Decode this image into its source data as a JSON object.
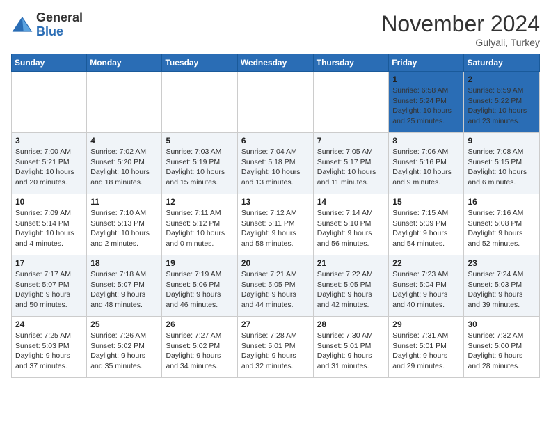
{
  "header": {
    "logo_general": "General",
    "logo_blue": "Blue",
    "month_title": "November 2024",
    "subtitle": "Gulyali, Turkey"
  },
  "weekdays": [
    "Sunday",
    "Monday",
    "Tuesday",
    "Wednesday",
    "Thursday",
    "Friday",
    "Saturday"
  ],
  "weeks": [
    [
      {
        "day": "",
        "info": ""
      },
      {
        "day": "",
        "info": ""
      },
      {
        "day": "",
        "info": ""
      },
      {
        "day": "",
        "info": ""
      },
      {
        "day": "",
        "info": ""
      },
      {
        "day": "1",
        "info": "Sunrise: 6:58 AM\nSunset: 5:24 PM\nDaylight: 10 hours\nand 25 minutes."
      },
      {
        "day": "2",
        "info": "Sunrise: 6:59 AM\nSunset: 5:22 PM\nDaylight: 10 hours\nand 23 minutes."
      }
    ],
    [
      {
        "day": "3",
        "info": "Sunrise: 7:00 AM\nSunset: 5:21 PM\nDaylight: 10 hours\nand 20 minutes."
      },
      {
        "day": "4",
        "info": "Sunrise: 7:02 AM\nSunset: 5:20 PM\nDaylight: 10 hours\nand 18 minutes."
      },
      {
        "day": "5",
        "info": "Sunrise: 7:03 AM\nSunset: 5:19 PM\nDaylight: 10 hours\nand 15 minutes."
      },
      {
        "day": "6",
        "info": "Sunrise: 7:04 AM\nSunset: 5:18 PM\nDaylight: 10 hours\nand 13 minutes."
      },
      {
        "day": "7",
        "info": "Sunrise: 7:05 AM\nSunset: 5:17 PM\nDaylight: 10 hours\nand 11 minutes."
      },
      {
        "day": "8",
        "info": "Sunrise: 7:06 AM\nSunset: 5:16 PM\nDaylight: 10 hours\nand 9 minutes."
      },
      {
        "day": "9",
        "info": "Sunrise: 7:08 AM\nSunset: 5:15 PM\nDaylight: 10 hours\nand 6 minutes."
      }
    ],
    [
      {
        "day": "10",
        "info": "Sunrise: 7:09 AM\nSunset: 5:14 PM\nDaylight: 10 hours\nand 4 minutes."
      },
      {
        "day": "11",
        "info": "Sunrise: 7:10 AM\nSunset: 5:13 PM\nDaylight: 10 hours\nand 2 minutes."
      },
      {
        "day": "12",
        "info": "Sunrise: 7:11 AM\nSunset: 5:12 PM\nDaylight: 10 hours\nand 0 minutes."
      },
      {
        "day": "13",
        "info": "Sunrise: 7:12 AM\nSunset: 5:11 PM\nDaylight: 9 hours\nand 58 minutes."
      },
      {
        "day": "14",
        "info": "Sunrise: 7:14 AM\nSunset: 5:10 PM\nDaylight: 9 hours\nand 56 minutes."
      },
      {
        "day": "15",
        "info": "Sunrise: 7:15 AM\nSunset: 5:09 PM\nDaylight: 9 hours\nand 54 minutes."
      },
      {
        "day": "16",
        "info": "Sunrise: 7:16 AM\nSunset: 5:08 PM\nDaylight: 9 hours\nand 52 minutes."
      }
    ],
    [
      {
        "day": "17",
        "info": "Sunrise: 7:17 AM\nSunset: 5:07 PM\nDaylight: 9 hours\nand 50 minutes."
      },
      {
        "day": "18",
        "info": "Sunrise: 7:18 AM\nSunset: 5:07 PM\nDaylight: 9 hours\nand 48 minutes."
      },
      {
        "day": "19",
        "info": "Sunrise: 7:19 AM\nSunset: 5:06 PM\nDaylight: 9 hours\nand 46 minutes."
      },
      {
        "day": "20",
        "info": "Sunrise: 7:21 AM\nSunset: 5:05 PM\nDaylight: 9 hours\nand 44 minutes."
      },
      {
        "day": "21",
        "info": "Sunrise: 7:22 AM\nSunset: 5:05 PM\nDaylight: 9 hours\nand 42 minutes."
      },
      {
        "day": "22",
        "info": "Sunrise: 7:23 AM\nSunset: 5:04 PM\nDaylight: 9 hours\nand 40 minutes."
      },
      {
        "day": "23",
        "info": "Sunrise: 7:24 AM\nSunset: 5:03 PM\nDaylight: 9 hours\nand 39 minutes."
      }
    ],
    [
      {
        "day": "24",
        "info": "Sunrise: 7:25 AM\nSunset: 5:03 PM\nDaylight: 9 hours\nand 37 minutes."
      },
      {
        "day": "25",
        "info": "Sunrise: 7:26 AM\nSunset: 5:02 PM\nDaylight: 9 hours\nand 35 minutes."
      },
      {
        "day": "26",
        "info": "Sunrise: 7:27 AM\nSunset: 5:02 PM\nDaylight: 9 hours\nand 34 minutes."
      },
      {
        "day": "27",
        "info": "Sunrise: 7:28 AM\nSunset: 5:01 PM\nDaylight: 9 hours\nand 32 minutes."
      },
      {
        "day": "28",
        "info": "Sunrise: 7:30 AM\nSunset: 5:01 PM\nDaylight: 9 hours\nand 31 minutes."
      },
      {
        "day": "29",
        "info": "Sunrise: 7:31 AM\nSunset: 5:01 PM\nDaylight: 9 hours\nand 29 minutes."
      },
      {
        "day": "30",
        "info": "Sunrise: 7:32 AM\nSunset: 5:00 PM\nDaylight: 9 hours\nand 28 minutes."
      }
    ]
  ],
  "colors": {
    "header_bg": "#2a6db5",
    "row_even": "#eef2f7",
    "row_odd": "#ffffff"
  }
}
